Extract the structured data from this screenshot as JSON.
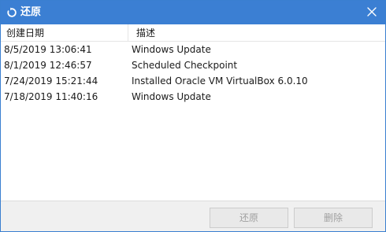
{
  "window": {
    "title": "还原"
  },
  "table": {
    "columns": [
      "创建日期",
      "描述"
    ],
    "rows": [
      {
        "date": "8/5/2019 13:06:41",
        "description": "Windows Update"
      },
      {
        "date": "8/1/2019 12:46:57",
        "description": "Scheduled Checkpoint"
      },
      {
        "date": "7/24/2019 15:21:44",
        "description": "Installed Oracle VM VirtualBox 6.0.10"
      },
      {
        "date": "7/18/2019 11:40:16",
        "description": "Windows Update"
      }
    ]
  },
  "buttons": {
    "restore": "还原",
    "delete": "删除"
  },
  "icons": {
    "title": "restore-icon",
    "close": "close-icon"
  },
  "colors": {
    "titlebar": "#3b7fd3",
    "disabled_text": "#a0a0a0"
  }
}
